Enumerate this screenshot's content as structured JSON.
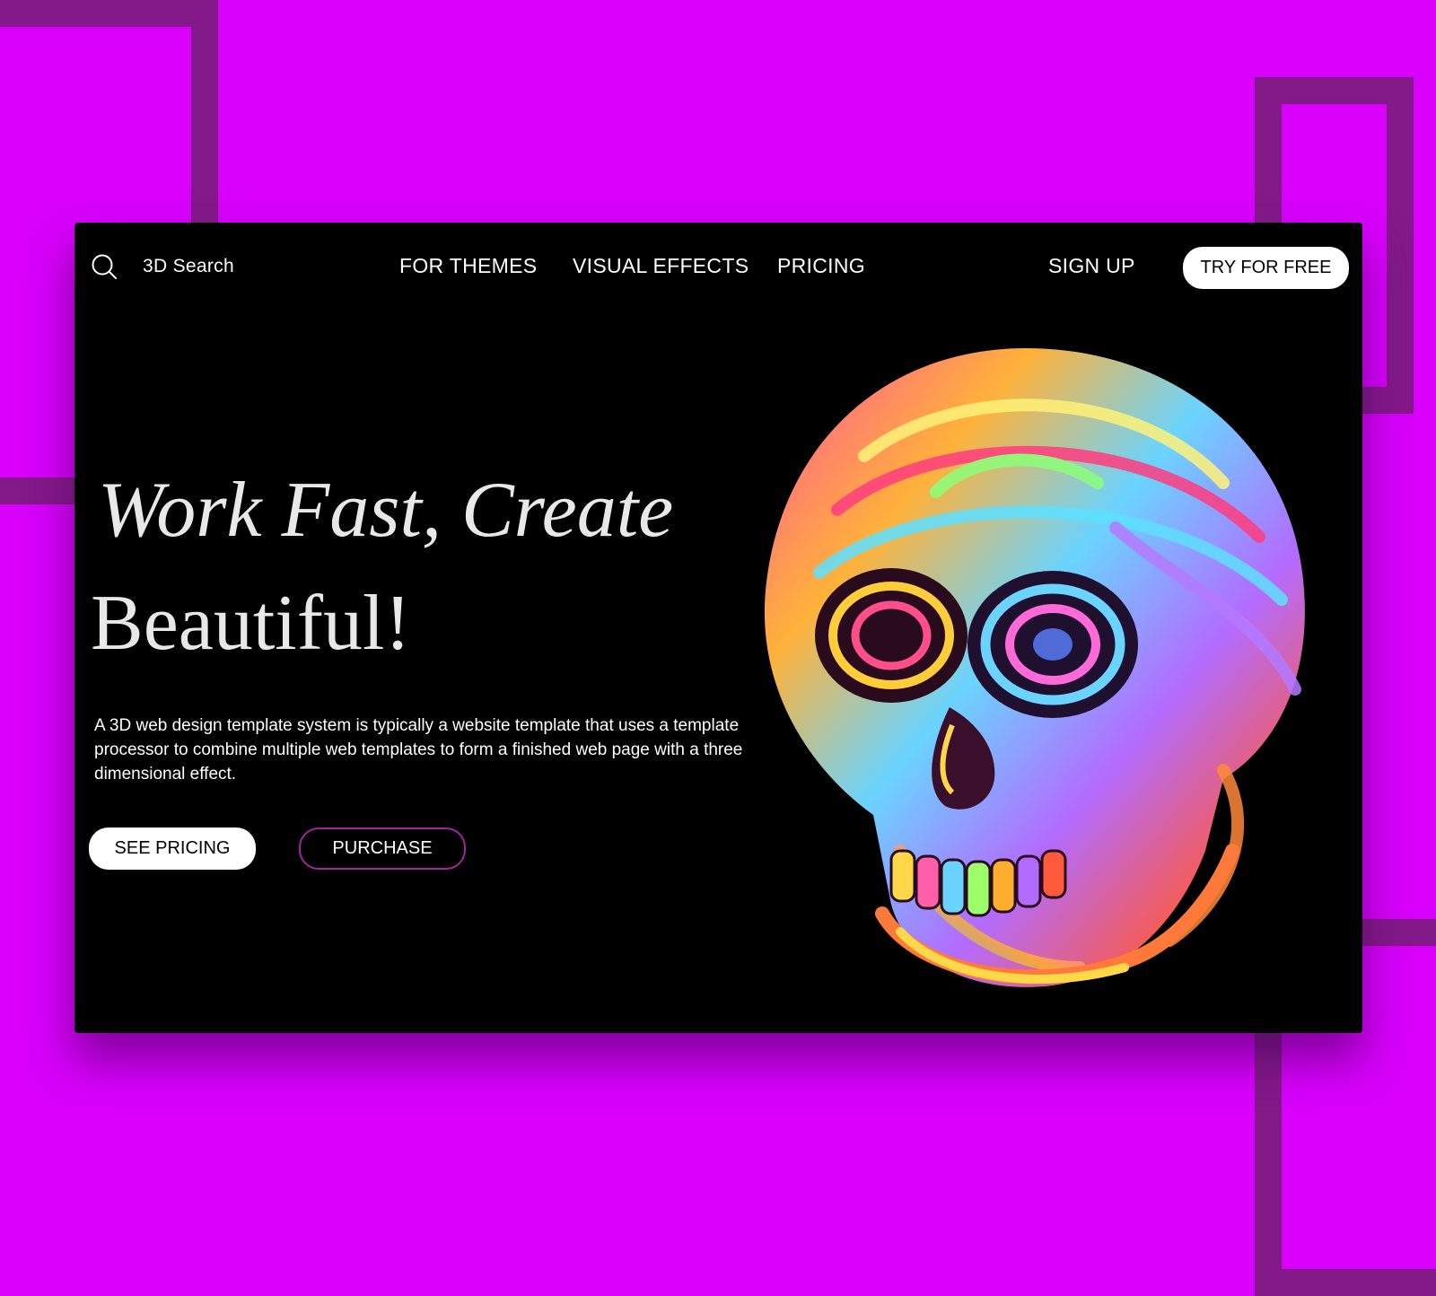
{
  "nav": {
    "search_label": "3D Search",
    "links": [
      "FOR THEMES",
      "VISUAL EFFECTS",
      "PRICING"
    ],
    "signup_label": "SIGN UP",
    "try_label": "TRY FOR FREE"
  },
  "hero": {
    "line1": "Work Fast, Create",
    "line2": "Beautiful!",
    "description": "A 3D web design template system is typically a website template that uses a template processor to combine multiple web templates to form a finished web page with a three dimensional effect.",
    "see_pricing_label": "SEE PRICING",
    "purchase_label": "PURCHASE"
  },
  "colors": {
    "background": "#d800fb",
    "frame_accent": "#84198a",
    "card": "#000000",
    "outline_button": "#a0269f"
  },
  "icons": {
    "search": "search-icon",
    "illustration": "rainbow-skull-illustration"
  }
}
